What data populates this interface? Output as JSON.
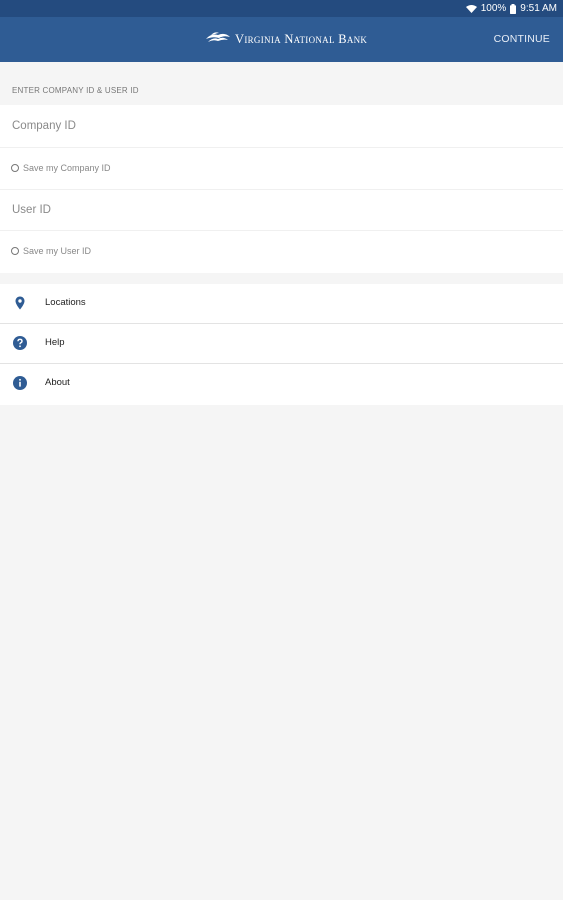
{
  "status_bar": {
    "battery": "100%",
    "time": "9:51 AM",
    "icons": [
      "wifi-icon",
      "battery-icon"
    ]
  },
  "app_bar": {
    "brand_name": "Virginia National Bank",
    "continue_label": "CONTINUE"
  },
  "login_form": {
    "section_header": "ENTER COMPANY ID & USER ID",
    "company_id": {
      "placeholder": "Company ID",
      "value": ""
    },
    "save_company_id": {
      "label": "Save my Company ID",
      "checked": false
    },
    "user_id": {
      "placeholder": "User ID",
      "value": ""
    },
    "save_user_id": {
      "label": "Save my User ID",
      "checked": false
    }
  },
  "menu": {
    "items": [
      {
        "label": "Locations",
        "icon": "location-pin-icon"
      },
      {
        "label": "Help",
        "icon": "help-icon"
      },
      {
        "label": "About",
        "icon": "info-icon"
      }
    ]
  },
  "colors": {
    "app_bar": "#2f5c94",
    "status_bar": "#244b7f",
    "icon_accent": "#2f5c94",
    "background": "#f5f5f5"
  }
}
